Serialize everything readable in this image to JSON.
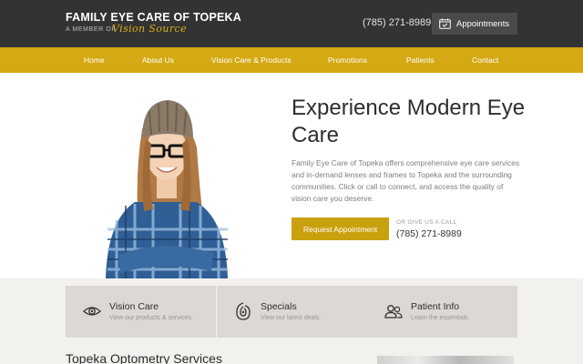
{
  "header": {
    "title": "FAMILY EYE CARE OF TOPEKA",
    "member_text": "A MEMBER OF",
    "member_logo_text": "Vision Source",
    "phone": "(785) 271-8989",
    "appointments_label": "Appointments",
    "appointments_icon": "calendar-check-icon"
  },
  "nav": {
    "items": [
      {
        "label": "Home"
      },
      {
        "label": "About Us"
      },
      {
        "label": "Vision Care & Products"
      },
      {
        "label": "Promotions"
      },
      {
        "label": "Patients"
      },
      {
        "label": "Contact"
      }
    ]
  },
  "hero": {
    "title": "Experience Modern Eye Care",
    "description": "Family Eye Care of Topeka offers comprehensive eye care services and in-demand lenses and frames to Topeka and the surrounding communities. Click or call to connect, and access the quality of vision care you deserve.",
    "cta_label": "Request Appointment",
    "call_label": "OR GIVE US A CALL",
    "call_phone": "(785) 271-8989"
  },
  "features": [
    {
      "title": "Vision Care",
      "subtitle": "View our products & services.",
      "icon": "eye-icon"
    },
    {
      "title": "Specials",
      "subtitle": "View our latest deals.",
      "icon": "tag-swirl-icon"
    },
    {
      "title": "Patient Info",
      "subtitle": "Learn the essentials.",
      "icon": "people-icon"
    }
  ],
  "section": {
    "heading": "Topeka Optometry Services"
  },
  "colors": {
    "header_bg": "#333333",
    "accent": "#d4a913",
    "button": "#c9a00e",
    "features_bg": "#f3f1ee",
    "card_bg": "#dcd8d3"
  }
}
